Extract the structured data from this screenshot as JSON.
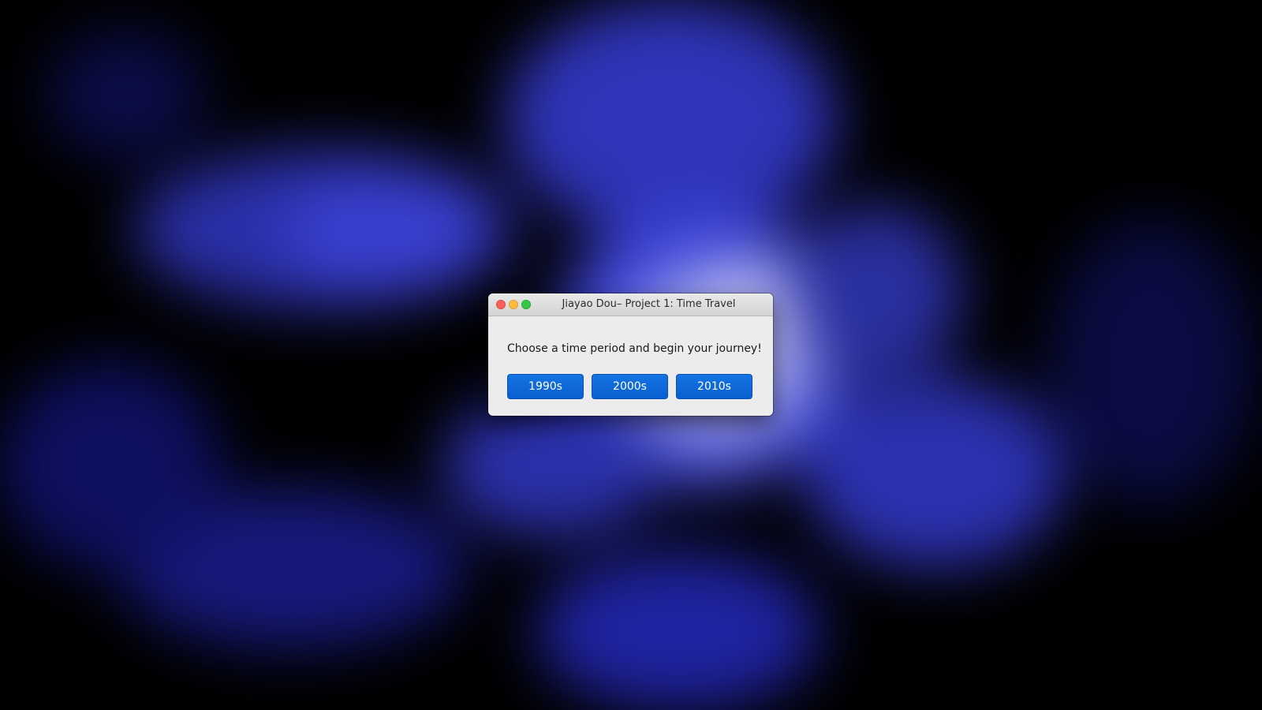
{
  "window": {
    "title": "Jiayao Dou– Project 1: Time Travel",
    "prompt": "Choose a time period and begin your journey!",
    "buttons": [
      {
        "label": "1990s"
      },
      {
        "label": "2000s"
      },
      {
        "label": "2010s"
      }
    ]
  },
  "colors": {
    "desktop_background": "#000000",
    "nebula": "#3a3fd6",
    "button": "#0a66d8",
    "window_background": "#ececec"
  },
  "icons": {
    "close": "close-icon",
    "minimize": "minimize-icon",
    "zoom": "zoom-icon"
  }
}
